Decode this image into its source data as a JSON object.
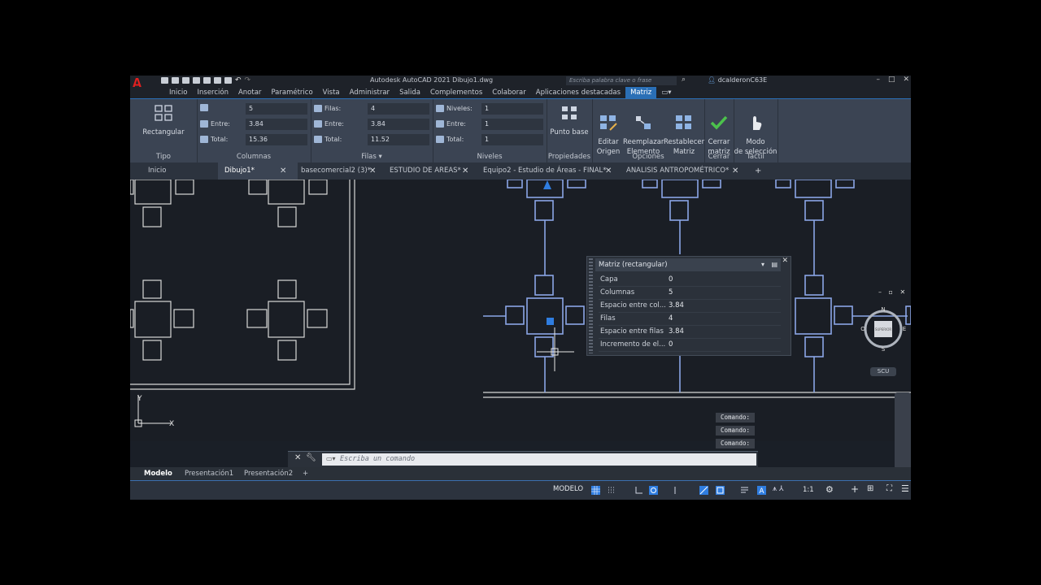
{
  "app": {
    "title": "Autodesk AutoCAD 2021    Dibujo1.dwg",
    "search_placeholder": "Escriba palabra clave o frase",
    "user": "dcalderonC63E"
  },
  "menu": [
    "Inicio",
    "Inserción",
    "Anotar",
    "Paramétrico",
    "Vista",
    "Administrar",
    "Salida",
    "Complementos",
    "Colaborar",
    "Aplicaciones destacadas",
    "Matriz"
  ],
  "ribbon": {
    "tipo": {
      "button": "Rectangular",
      "label": "Tipo"
    },
    "columnas": {
      "label": "Columnas",
      "count": "5",
      "entre_label": "Entre:",
      "entre": "3.84",
      "total_label": "Total:",
      "total": "15.36"
    },
    "filas": {
      "label": "Filas",
      "count_label": "Filas:",
      "count": "4",
      "entre_label": "Entre:",
      "entre": "3.84",
      "total_label": "Total:",
      "total": "11.52"
    },
    "niveles": {
      "label": "Niveles",
      "count_label": "Niveles:",
      "count": "1",
      "entre_label": "Entre:",
      "entre": "1",
      "total_label": "Total:",
      "total": "1"
    },
    "propiedades": {
      "label": "Propiedades",
      "punto_base": "Punto base"
    },
    "opciones": {
      "label": "Opciones",
      "editar": "Editar\nOrigen",
      "reemplazar": "Reemplazar\nElemento",
      "restablecer": "Restablecer\nMatriz"
    },
    "cerrar": {
      "label": "Cerrar",
      "button": "Cerrar\nmatriz"
    },
    "tactil": {
      "label": "Táctil",
      "button": "Modo\nde selección"
    }
  },
  "doc_tabs": [
    {
      "label": "Inicio"
    },
    {
      "label": "Dibujo1*"
    },
    {
      "label": "basecomercial2 (3)*"
    },
    {
      "label": "ESTUDIO DE AREAS*"
    },
    {
      "label": "Equipo2 - Estudio de Áreas - FINAL*"
    },
    {
      "label": "ANALISIS ANTROPOMÉTRICO*"
    }
  ],
  "viewcube": {
    "n": "N",
    "s": "S",
    "e": "E",
    "o": "O",
    "face": "SUPERIOR",
    "scu": "SCU"
  },
  "props_palette": {
    "title": "Matriz (rectangular)",
    "rows": [
      {
        "k": "Capa",
        "v": "0"
      },
      {
        "k": "Columnas",
        "v": "5"
      },
      {
        "k": "Espacio entre col...",
        "v": "3.84"
      },
      {
        "k": "Filas",
        "v": "4"
      },
      {
        "k": "Espacio entre filas",
        "v": "3.84"
      },
      {
        "k": "Incremento de el...",
        "v": "0"
      }
    ]
  },
  "command_history": [
    "Comando:",
    "Comando:",
    "Comando:"
  ],
  "command_placeholder": "Escriba un comando",
  "layout_tabs": [
    "Modelo",
    "Presentación1",
    "Presentación2"
  ],
  "status": {
    "modelo": "MODELO",
    "scale": "1:1"
  },
  "ucs": {
    "x": "X",
    "y": "Y"
  },
  "colors": {
    "accent": "#2a6fb6",
    "geometry_selected": "#8aa6e6",
    "geometry": "#d8d8d8",
    "ok_green": "#4cc24c"
  }
}
